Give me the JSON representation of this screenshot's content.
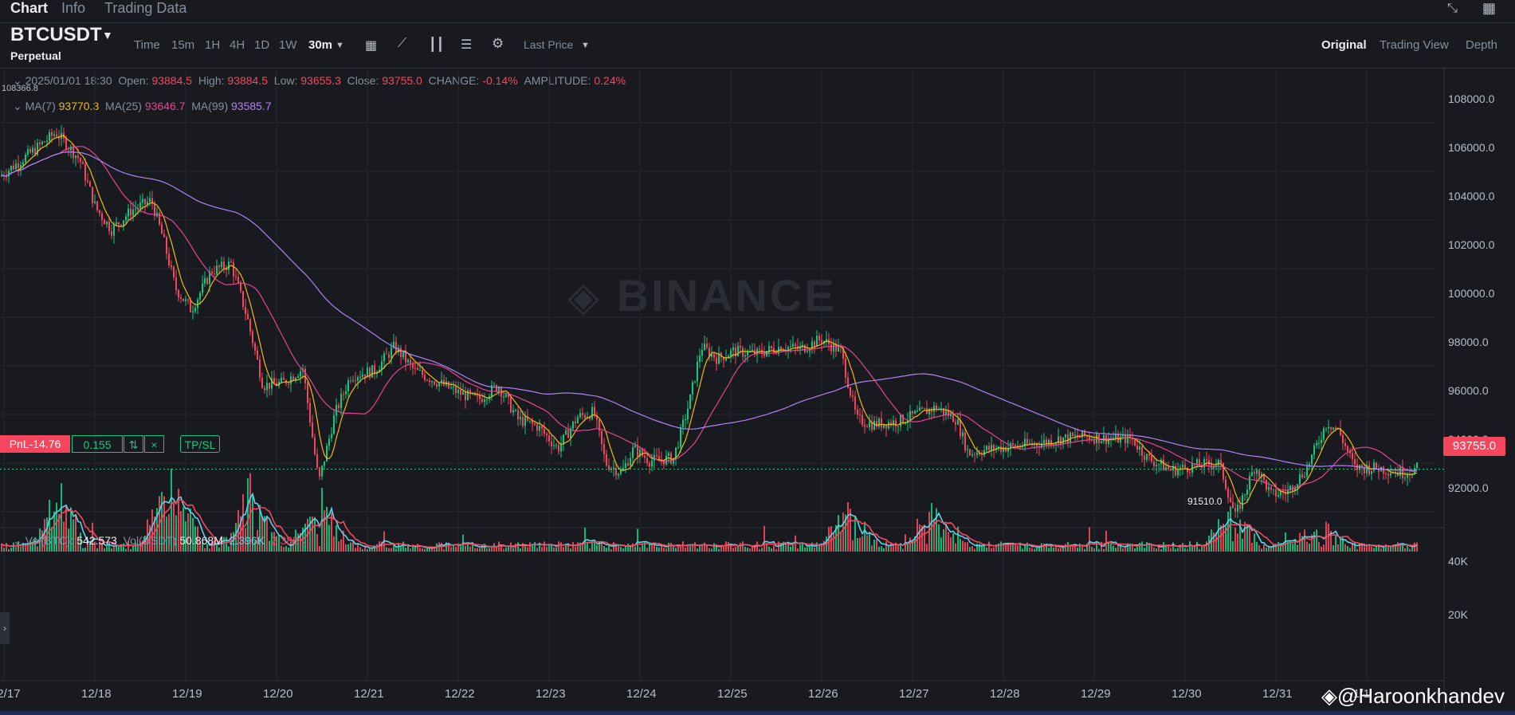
{
  "tabs": [
    {
      "label": "Chart"
    },
    {
      "label": "Info"
    },
    {
      "label": "Trading Data"
    }
  ],
  "symbol": {
    "name": "BTCUSDT",
    "type": "Perpetual"
  },
  "intervals": [
    "Time",
    "15m",
    "1H",
    "4H",
    "1D",
    "1W",
    "30m"
  ],
  "price_type": "Last Price",
  "view_tabs": [
    "Original",
    "Trading View",
    "Depth"
  ],
  "ohlc": {
    "date": "2025/01/01 18:30",
    "open_label": "Open:",
    "open": "93884.5",
    "high_label": "High:",
    "high": "93884.5",
    "low_label": "Low:",
    "low": "93655.3",
    "close_label": "Close:",
    "close": "93755.0",
    "change_label": "CHANGE:",
    "change": "-0.14%",
    "amp_label": "AMPLITUDE:",
    "amp": "0.24%"
  },
  "ma": {
    "ma7_label": "MA(7)",
    "ma7": "93770.3",
    "ma25_label": "MA(25)",
    "ma25": "93646.7",
    "ma99_label": "MA(99)",
    "ma99": "93585.7"
  },
  "hi_marker": "108366.8",
  "lo_marker": "91510.0",
  "price_axis": [
    "108000.0",
    "106000.0",
    "104000.0",
    "102000.0",
    "100000.0",
    "98000.0",
    "96000.0",
    "94000.0",
    "92000.0"
  ],
  "position": {
    "pnl": "PnL-14.76",
    "qty": "0.155",
    "swap": "⇅",
    "close": "×",
    "tpsl": "TP/SL"
  },
  "last_price": "93755.0",
  "volume": {
    "btc_label": "Vol(BTC):",
    "btc": "542.573",
    "usdt_label": "Vol(USDT)",
    "usdt": "50.868M",
    "ma5": "2.396K",
    "ma10": "2.388K"
  },
  "vol_axis": [
    "40K",
    "20K"
  ],
  "dates": [
    "12/17",
    "12/18",
    "12/19",
    "12/20",
    "12/21",
    "12/22",
    "12/23",
    "12/24",
    "12/25",
    "12/26",
    "12/27",
    "12/28",
    "12/29",
    "12/30",
    "12/31",
    "1/1"
  ],
  "watermark": "BINANCE",
  "credit": "@Haroonkhandev",
  "colors": {
    "up": "#0ecb81",
    "down": "#f6465d",
    "ma7": "#f0b90b",
    "ma25": "#e84393",
    "ma99": "#b281f5",
    "vol_ma": "#5dd3e8",
    "bg": "#181a20"
  },
  "chart_data": {
    "type": "candlestick",
    "x": [
      "12/17",
      "12/18",
      "12/19",
      "12/20",
      "12/21",
      "12/22",
      "12/23",
      "12/24",
      "12/25",
      "12/26",
      "12/27",
      "12/28",
      "12/29",
      "12/30",
      "12/31",
      "1/1"
    ],
    "close_approx": [
      106000,
      105500,
      102000,
      97500,
      97800,
      96500,
      95200,
      94300,
      98500,
      98900,
      95800,
      94500,
      94900,
      93600,
      94200,
      93755
    ],
    "ylim": [
      91000,
      109000
    ],
    "high": 108366.8,
    "low": 91510.0,
    "series": [
      {
        "name": "MA(7)"
      },
      {
        "name": "MA(25)"
      },
      {
        "name": "MA(99)"
      }
    ]
  }
}
